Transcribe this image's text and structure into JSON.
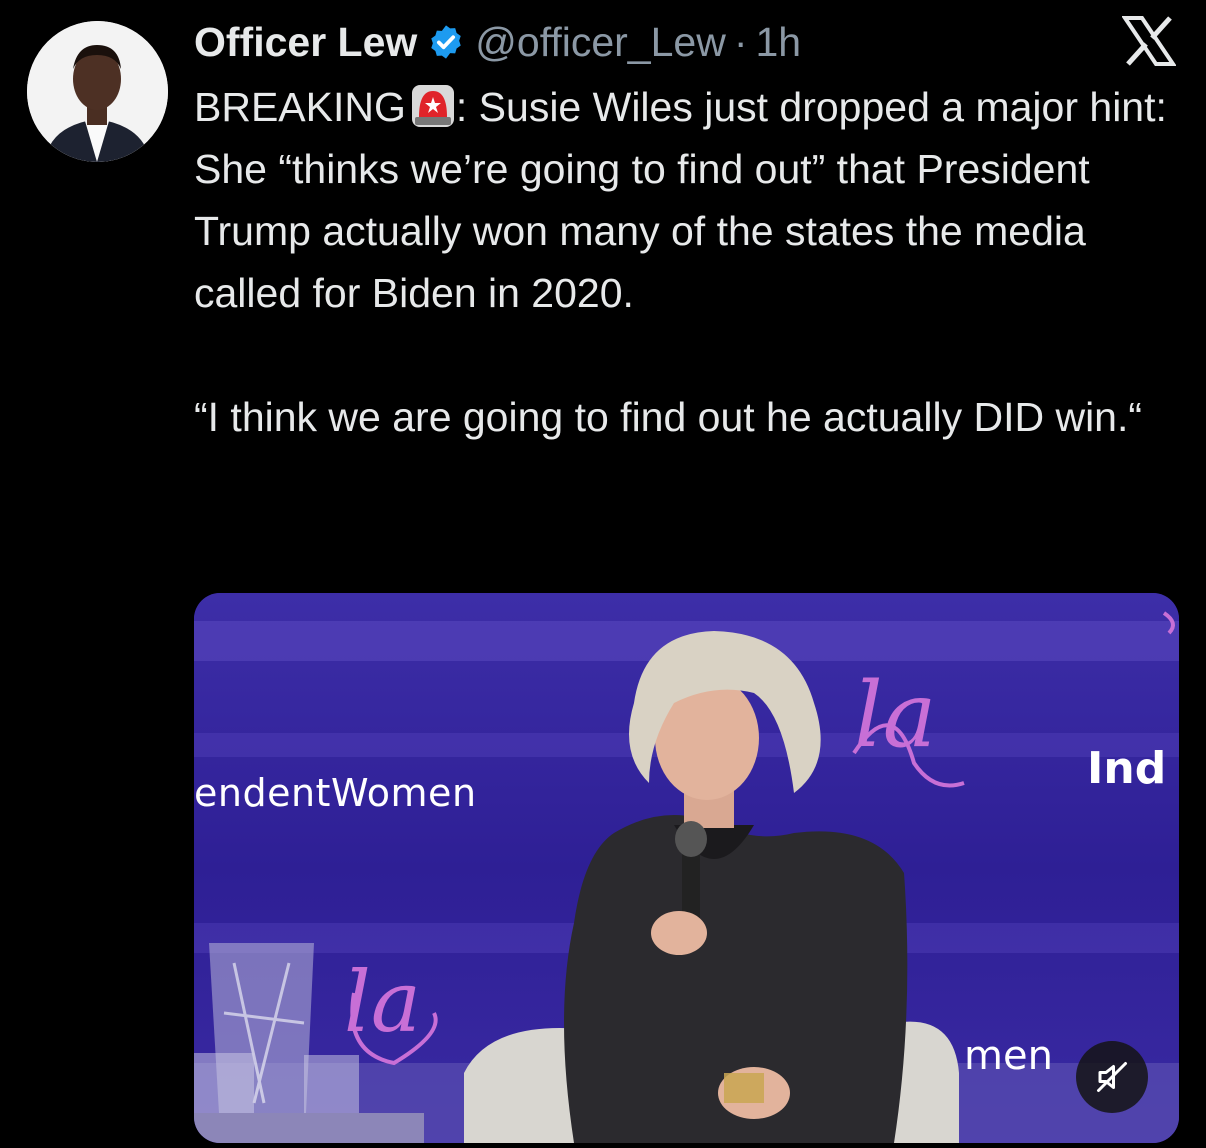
{
  "tweet": {
    "author_name": "Officer Lew",
    "handle": "@officer_Lew",
    "separator": "·",
    "time": "1h",
    "text_line_1": "BREAKING",
    "text_line_1_rest": ": Susie Wiles just dropped a major hint: She “thinks we’re going to find out” that President Trump actually won many of the states the media called for Biden in 2020.",
    "quote": "“I think we are going to find out he actually DID win.“"
  },
  "media": {
    "backdrop_text_left": "endentWomen",
    "backdrop_text_right": "Ind",
    "backdrop_text_bottom": "men",
    "script_text_top": "la",
    "script_text_bottom": "la"
  },
  "icons": {
    "verified": "verified-badge-icon",
    "close": "x-logo-icon",
    "siren": "siren-emoji-icon",
    "mute": "speaker-muted-icon"
  },
  "colors": {
    "background": "#000000",
    "text": "#e7e9ea",
    "muted": "#8b98a5",
    "verified": "#1d9bf0"
  }
}
